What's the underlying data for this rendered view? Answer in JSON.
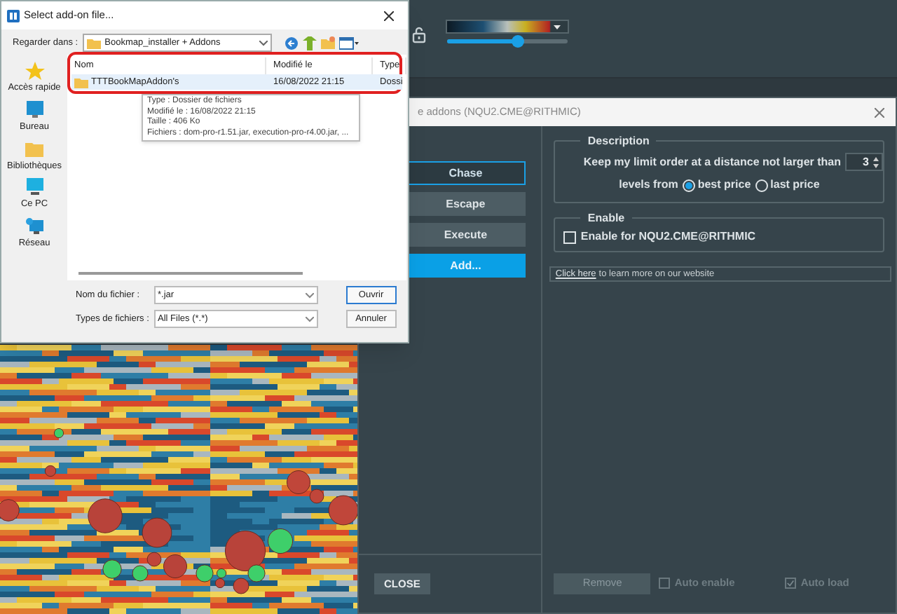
{
  "color_scale": {
    "level": 0.58
  },
  "addons_window": {
    "title": "e addons (NQU2.CME@RITHMIC)",
    "addons": [
      {
        "label": "Chase",
        "kind": "addon",
        "selected": true
      },
      {
        "label": "Escape",
        "kind": "addon",
        "selected": false
      },
      {
        "label": "Execute",
        "kind": "addon",
        "selected": false
      },
      {
        "label": "Add...",
        "kind": "add",
        "selected": false
      }
    ],
    "description": {
      "heading": "Description",
      "line1": "Keep my limit order at a distance not larger than",
      "distance": "3",
      "line2": "levels from",
      "options": [
        {
          "label": "best price",
          "selected": true
        },
        {
          "label": "last price",
          "selected": false
        }
      ]
    },
    "enable": {
      "heading": "Enable",
      "label": "Enable for NQU2.CME@RITHMIC",
      "checked": false
    },
    "link": {
      "text": "Click here",
      "rest": "to learn more on our website"
    },
    "close_button": "CLOSE",
    "remove_button": {
      "label": "Remove",
      "disabled": true
    },
    "options": [
      {
        "label": "Auto enable",
        "checked": false,
        "disabled": true
      },
      {
        "label": "Auto load",
        "checked": true,
        "disabled": true
      }
    ]
  },
  "file_dialog": {
    "title": "Select add-on file...",
    "look_in_label": "Regarder dans :",
    "look_in": "Bookmap_installer + Addons",
    "places": [
      "Accès rapide",
      "Bureau",
      "Bibliothèques",
      "Ce PC",
      "Réseau"
    ],
    "columns": [
      "Nom",
      "Modifié le",
      "Type"
    ],
    "rows": [
      {
        "name": "TTTBookMapAddon's",
        "modified": "16/08/2022 21:15",
        "type": "Dossi",
        "selected": true
      }
    ],
    "tooltip": [
      "Type : Dossier de fichiers",
      "Modifié le : 16/08/2022 21:15",
      "Taille : 406 Ko",
      "Fichiers : dom-pro-r1.51.jar, execution-pro-r4.00.jar, ..."
    ],
    "file_name_label": "Nom du fichier :",
    "file_name": "*.jar",
    "file_type_label": "Types de fichiers :",
    "file_type": "All Files (*.*)",
    "buttons": [
      "Ouvrir",
      "Annuler"
    ]
  }
}
